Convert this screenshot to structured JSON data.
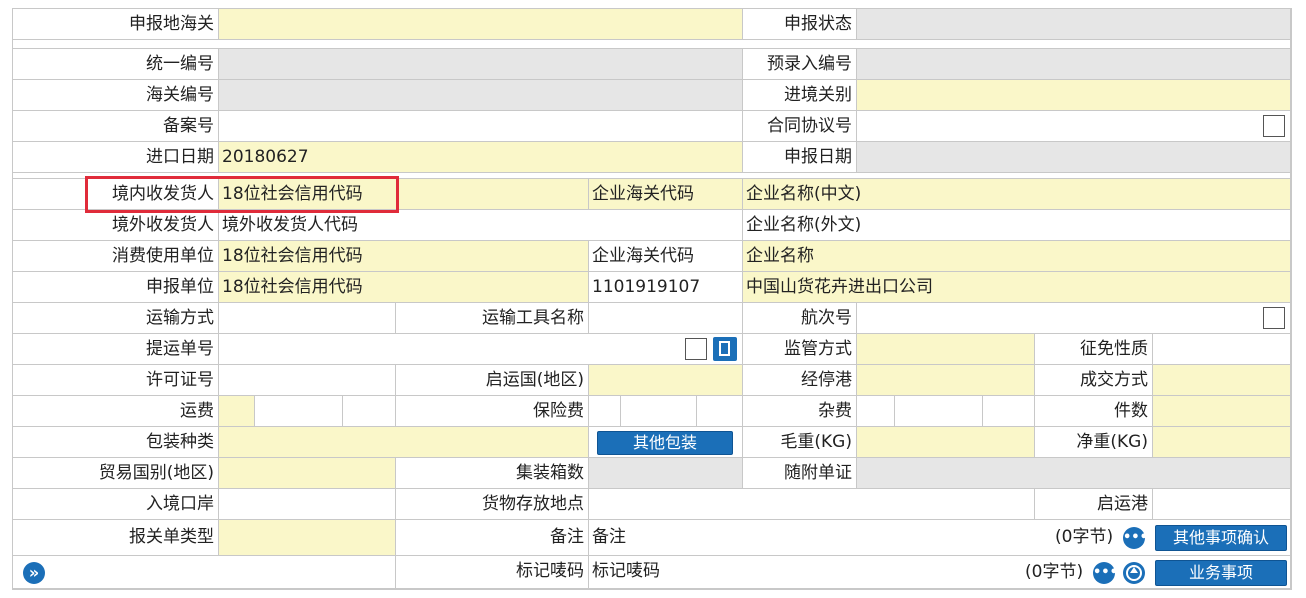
{
  "labels": {
    "declare_customs": "申报地海关",
    "declare_status": "申报状态",
    "unified_no": "统一编号",
    "pre_entry_no": "预录入编号",
    "customs_no": "海关编号",
    "entry_customs": "进境关别",
    "record_no": "备案号",
    "contract_no": "合同协议号",
    "import_date": "进口日期",
    "declare_date": "申报日期",
    "domestic_consignee": "境内收发货人",
    "foreign_consignor": "境外收发货人",
    "consumer_unit": "消费使用单位",
    "declare_unit": "申报单位",
    "transport_mode": "运输方式",
    "transport_tool": "运输工具名称",
    "voyage_no": "航次号",
    "bill_no": "提运单号",
    "supervision_mode": "监管方式",
    "levy_nature": "征免性质",
    "license_no": "许可证号",
    "departure_country": "启运国(地区)",
    "stop_port": "经停港",
    "deal_mode": "成交方式",
    "freight": "运费",
    "insurance": "保险费",
    "misc_fee": "杂费",
    "pieces": "件数",
    "pack_type": "包装种类",
    "gross_weight": "毛重(KG)",
    "net_weight": "净重(KG)",
    "trade_country": "贸易国别(地区)",
    "container_count": "集装箱数",
    "attached_docs": "随附单证",
    "entry_port": "入境口岸",
    "goods_location": "货物存放地点",
    "departure_port": "启运港",
    "declaration_type": "报关单类型",
    "remark": "备注",
    "marks": "标记唛码"
  },
  "values": {
    "import_date": "20180627",
    "domestic_credit_code": "18位社会信用代码",
    "domestic_customs_code_ph": "企业海关代码",
    "domestic_name_cn": "企业名称(中文)",
    "foreign_code_ph": "境外收发货人代码",
    "foreign_name_en": "企业名称(外文)",
    "consumer_credit_code": "18位社会信用代码",
    "consumer_customs_code_ph": "企业海关代码",
    "consumer_name": "企业名称",
    "declare_credit_code": "18位社会信用代码",
    "declare_customs_code": "1101919107",
    "declare_company": "中国山货花卉进出口公司",
    "remark_ph": "备注",
    "marks_ph": "标记唛码",
    "remark_bytes": "(0字节)",
    "marks_bytes": "(0字节)"
  },
  "buttons": {
    "other_packaging": "其他包装",
    "other_confirm": "其他事项确认",
    "business_items": "业务事项"
  },
  "icons": {
    "expand": "»",
    "more": "•••"
  },
  "colors": {
    "yellow_field": "#faf7c9",
    "grey_field": "#e6e6e6",
    "button_blue": "#1b6fb8",
    "highlight_red": "#e02b3a"
  }
}
